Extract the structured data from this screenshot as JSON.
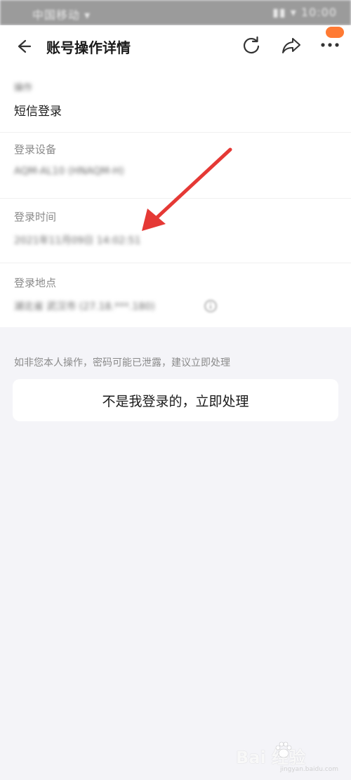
{
  "status_bar": {
    "carrier": "中国移动 ▾ ",
    "right": "▮▮ ▾ 10:00"
  },
  "header": {
    "title": "账号操作详情"
  },
  "info": {
    "operation_label": "操作",
    "operation_value": "短信登录",
    "device_label": "登录设备",
    "device_value": "AQM-AL10 (HNAQM-H)",
    "time_label": "登录时间",
    "time_value": "2021年11月09日 14:02:51",
    "location_label": "登录地点",
    "location_value": "湖北省 武汉市 (27.18.***.180)"
  },
  "warning": {
    "text": "如非您本人操作，密码可能已泄露，建议立即处理",
    "button_label": "不是我登录的，立即处理"
  },
  "watermark": {
    "logo": "Bai  经验",
    "url": "jingyan.baidu.com"
  },
  "colors": {
    "background": "#f4f4f8",
    "card": "#ffffff",
    "annotation_arrow": "#e53935",
    "badge": "#ff7a33"
  }
}
